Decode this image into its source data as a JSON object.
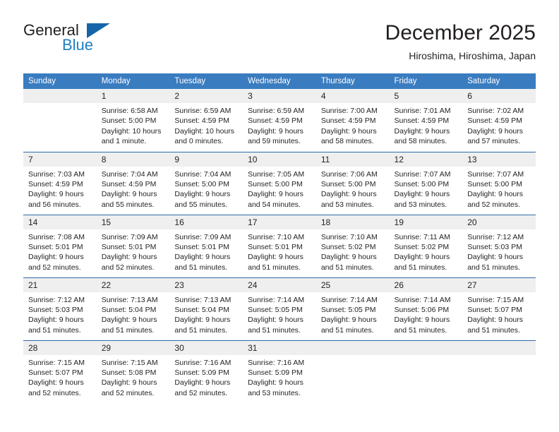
{
  "brand": {
    "name_top": "General",
    "name_bottom": "Blue",
    "triangle_icon": "triangle-icon",
    "color_dark": "#231f20",
    "color_blue": "#1e7fc7"
  },
  "header": {
    "title": "December 2025",
    "subtitle": "Hiroshima, Hiroshima, Japan"
  },
  "theme": {
    "header_bg": "#3a7cc0",
    "header_text": "#ffffff",
    "daynum_bg": "#efefef",
    "grid_line": "#2f6cab",
    "body_text": "#231f20"
  },
  "calendar": {
    "weekday_headers": [
      "Sunday",
      "Monday",
      "Tuesday",
      "Wednesday",
      "Thursday",
      "Friday",
      "Saturday"
    ],
    "weeks": [
      [
        {
          "day": "",
          "lines": []
        },
        {
          "day": "1",
          "lines": [
            "Sunrise: 6:58 AM",
            "Sunset: 5:00 PM",
            "Daylight: 10 hours",
            "and 1 minute."
          ]
        },
        {
          "day": "2",
          "lines": [
            "Sunrise: 6:59 AM",
            "Sunset: 4:59 PM",
            "Daylight: 10 hours",
            "and 0 minutes."
          ]
        },
        {
          "day": "3",
          "lines": [
            "Sunrise: 6:59 AM",
            "Sunset: 4:59 PM",
            "Daylight: 9 hours",
            "and 59 minutes."
          ]
        },
        {
          "day": "4",
          "lines": [
            "Sunrise: 7:00 AM",
            "Sunset: 4:59 PM",
            "Daylight: 9 hours",
            "and 58 minutes."
          ]
        },
        {
          "day": "5",
          "lines": [
            "Sunrise: 7:01 AM",
            "Sunset: 4:59 PM",
            "Daylight: 9 hours",
            "and 58 minutes."
          ]
        },
        {
          "day": "6",
          "lines": [
            "Sunrise: 7:02 AM",
            "Sunset: 4:59 PM",
            "Daylight: 9 hours",
            "and 57 minutes."
          ]
        }
      ],
      [
        {
          "day": "7",
          "lines": [
            "Sunrise: 7:03 AM",
            "Sunset: 4:59 PM",
            "Daylight: 9 hours",
            "and 56 minutes."
          ]
        },
        {
          "day": "8",
          "lines": [
            "Sunrise: 7:04 AM",
            "Sunset: 4:59 PM",
            "Daylight: 9 hours",
            "and 55 minutes."
          ]
        },
        {
          "day": "9",
          "lines": [
            "Sunrise: 7:04 AM",
            "Sunset: 5:00 PM",
            "Daylight: 9 hours",
            "and 55 minutes."
          ]
        },
        {
          "day": "10",
          "lines": [
            "Sunrise: 7:05 AM",
            "Sunset: 5:00 PM",
            "Daylight: 9 hours",
            "and 54 minutes."
          ]
        },
        {
          "day": "11",
          "lines": [
            "Sunrise: 7:06 AM",
            "Sunset: 5:00 PM",
            "Daylight: 9 hours",
            "and 53 minutes."
          ]
        },
        {
          "day": "12",
          "lines": [
            "Sunrise: 7:07 AM",
            "Sunset: 5:00 PM",
            "Daylight: 9 hours",
            "and 53 minutes."
          ]
        },
        {
          "day": "13",
          "lines": [
            "Sunrise: 7:07 AM",
            "Sunset: 5:00 PM",
            "Daylight: 9 hours",
            "and 52 minutes."
          ]
        }
      ],
      [
        {
          "day": "14",
          "lines": [
            "Sunrise: 7:08 AM",
            "Sunset: 5:01 PM",
            "Daylight: 9 hours",
            "and 52 minutes."
          ]
        },
        {
          "day": "15",
          "lines": [
            "Sunrise: 7:09 AM",
            "Sunset: 5:01 PM",
            "Daylight: 9 hours",
            "and 52 minutes."
          ]
        },
        {
          "day": "16",
          "lines": [
            "Sunrise: 7:09 AM",
            "Sunset: 5:01 PM",
            "Daylight: 9 hours",
            "and 51 minutes."
          ]
        },
        {
          "day": "17",
          "lines": [
            "Sunrise: 7:10 AM",
            "Sunset: 5:01 PM",
            "Daylight: 9 hours",
            "and 51 minutes."
          ]
        },
        {
          "day": "18",
          "lines": [
            "Sunrise: 7:10 AM",
            "Sunset: 5:02 PM",
            "Daylight: 9 hours",
            "and 51 minutes."
          ]
        },
        {
          "day": "19",
          "lines": [
            "Sunrise: 7:11 AM",
            "Sunset: 5:02 PM",
            "Daylight: 9 hours",
            "and 51 minutes."
          ]
        },
        {
          "day": "20",
          "lines": [
            "Sunrise: 7:12 AM",
            "Sunset: 5:03 PM",
            "Daylight: 9 hours",
            "and 51 minutes."
          ]
        }
      ],
      [
        {
          "day": "21",
          "lines": [
            "Sunrise: 7:12 AM",
            "Sunset: 5:03 PM",
            "Daylight: 9 hours",
            "and 51 minutes."
          ]
        },
        {
          "day": "22",
          "lines": [
            "Sunrise: 7:13 AM",
            "Sunset: 5:04 PM",
            "Daylight: 9 hours",
            "and 51 minutes."
          ]
        },
        {
          "day": "23",
          "lines": [
            "Sunrise: 7:13 AM",
            "Sunset: 5:04 PM",
            "Daylight: 9 hours",
            "and 51 minutes."
          ]
        },
        {
          "day": "24",
          "lines": [
            "Sunrise: 7:14 AM",
            "Sunset: 5:05 PM",
            "Daylight: 9 hours",
            "and 51 minutes."
          ]
        },
        {
          "day": "25",
          "lines": [
            "Sunrise: 7:14 AM",
            "Sunset: 5:05 PM",
            "Daylight: 9 hours",
            "and 51 minutes."
          ]
        },
        {
          "day": "26",
          "lines": [
            "Sunrise: 7:14 AM",
            "Sunset: 5:06 PM",
            "Daylight: 9 hours",
            "and 51 minutes."
          ]
        },
        {
          "day": "27",
          "lines": [
            "Sunrise: 7:15 AM",
            "Sunset: 5:07 PM",
            "Daylight: 9 hours",
            "and 51 minutes."
          ]
        }
      ],
      [
        {
          "day": "28",
          "lines": [
            "Sunrise: 7:15 AM",
            "Sunset: 5:07 PM",
            "Daylight: 9 hours",
            "and 52 minutes."
          ]
        },
        {
          "day": "29",
          "lines": [
            "Sunrise: 7:15 AM",
            "Sunset: 5:08 PM",
            "Daylight: 9 hours",
            "and 52 minutes."
          ]
        },
        {
          "day": "30",
          "lines": [
            "Sunrise: 7:16 AM",
            "Sunset: 5:09 PM",
            "Daylight: 9 hours",
            "and 52 minutes."
          ]
        },
        {
          "day": "31",
          "lines": [
            "Sunrise: 7:16 AM",
            "Sunset: 5:09 PM",
            "Daylight: 9 hours",
            "and 53 minutes."
          ]
        },
        {
          "day": "",
          "lines": []
        },
        {
          "day": "",
          "lines": []
        },
        {
          "day": "",
          "lines": []
        }
      ]
    ]
  }
}
